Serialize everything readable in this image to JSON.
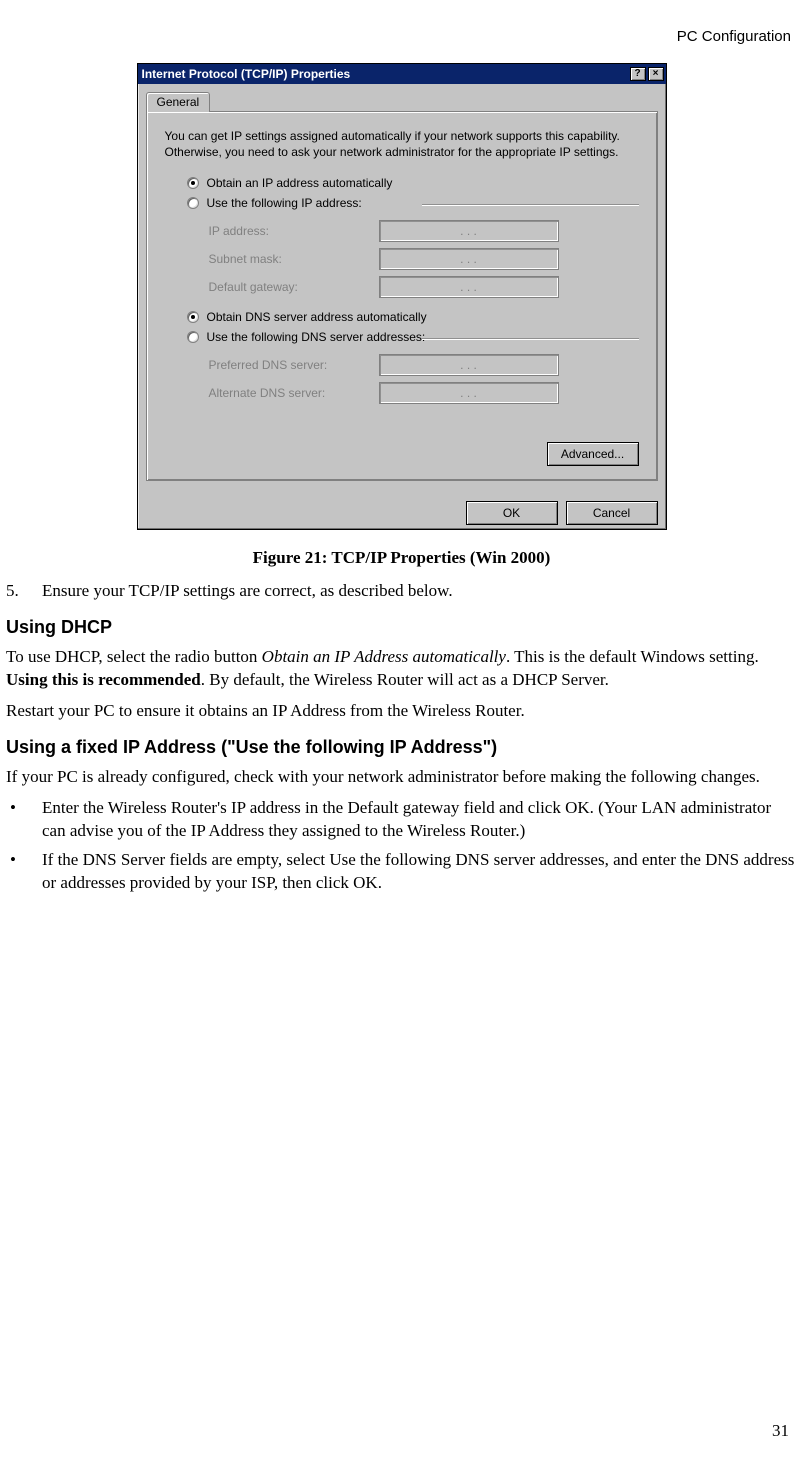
{
  "header": {
    "section": "PC Configuration"
  },
  "page_number": "31",
  "dialog": {
    "title": "Internet Protocol (TCP/IP) Properties",
    "help_btn": "?",
    "close_btn": "×",
    "tab_general": "General",
    "intro": "You can get IP settings assigned automatically if your network supports this capability. Otherwise, you need to ask your network administrator for the appropriate IP settings.",
    "radio_ip_auto": "Obtain an IP address automatically",
    "radio_ip_manual": "Use the following IP address:",
    "labels": {
      "ip": "IP address:",
      "subnet": "Subnet mask:",
      "gateway": "Default gateway:",
      "pref_dns": "Preferred DNS server:",
      "alt_dns": "Alternate DNS server:"
    },
    "radio_dns_auto": "Obtain DNS server address automatically",
    "radio_dns_manual": "Use the following DNS server addresses:",
    "btn_advanced": "Advanced...",
    "btn_ok": "OK",
    "btn_cancel": "Cancel",
    "ip_dots": ".     .     ."
  },
  "caption": "Figure 21: TCP/IP Properties (Win 2000)",
  "step5": {
    "num": "5.",
    "text": "Ensure your TCP/IP settings are correct, as described below."
  },
  "sec_dhcp": {
    "title": "Using DHCP",
    "p1_a": "To use DHCP, select the radio button ",
    "p1_ital": "Obtain an IP Address automatically",
    "p1_b": ". This is the default Windows setting. ",
    "p1_bold": "Using this is recommended",
    "p1_c": ". By default, the Wireless Router will act as a DHCP Server.",
    "p2": "Restart your PC to ensure it obtains an IP Address from the Wireless Router."
  },
  "sec_fixed": {
    "title": "Using a fixed IP Address (\"Use the following IP Address\")",
    "p1": "If your PC is already configured, check with your network administrator before making the following changes.",
    "b1_a": "Enter the Wireless Router's IP address in the ",
    "b1_i1": "Default gateway",
    "b1_b": " field and click ",
    "b1_i2": "OK",
    "b1_c": ". (Your LAN administrator can advise you of the IP Address they assigned to the Wireless Router.)",
    "b2_a": "If the ",
    "b2_i1": "DNS Server",
    "b2_b": " fields are empty, select ",
    "b2_i2": "Use the following DNS server addresses",
    "b2_c": ", and enter the DNS address or addresses provided by your ISP, then click ",
    "b2_i3": "OK",
    "b2_d": "."
  }
}
